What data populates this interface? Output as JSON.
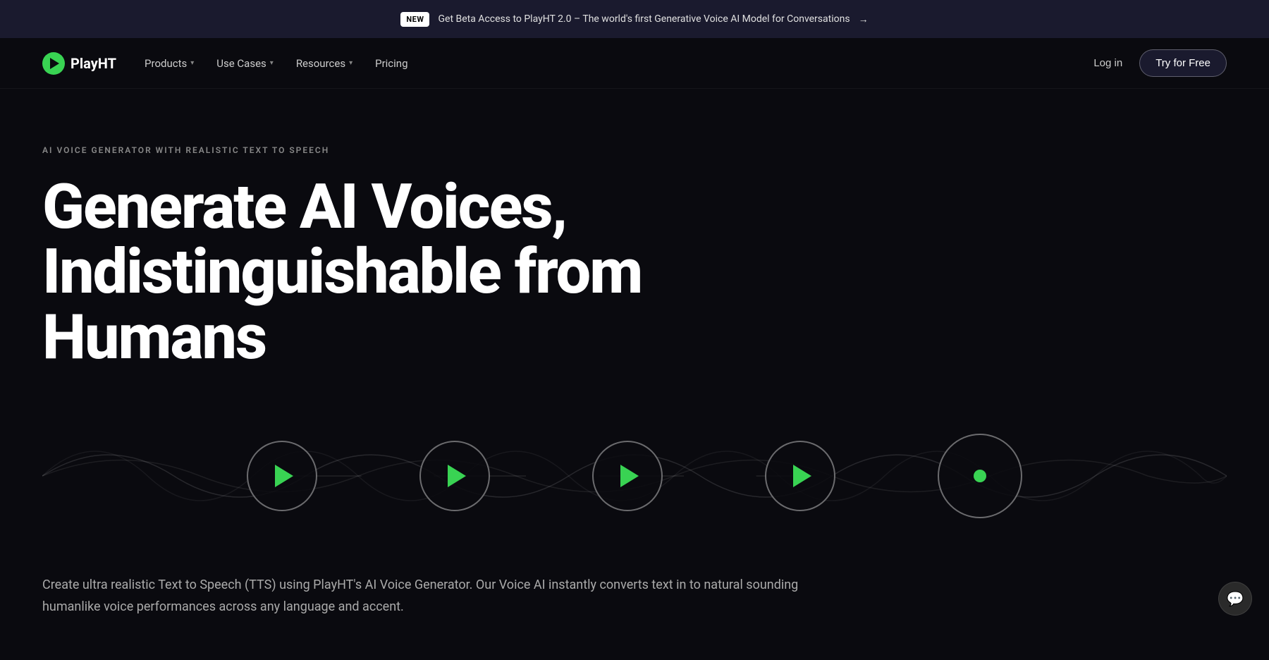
{
  "banner": {
    "badge": "NEW",
    "text": "Get Beta Access to PlayHT 2.0 – The world's first Generative Voice AI Model for Conversations",
    "arrow": "→"
  },
  "navbar": {
    "logo_text": "PlayHT",
    "nav_items": [
      {
        "label": "Products",
        "has_dropdown": true
      },
      {
        "label": "Use Cases",
        "has_dropdown": true
      },
      {
        "label": "Resources",
        "has_dropdown": true
      },
      {
        "label": "Pricing",
        "has_dropdown": false
      }
    ],
    "login_label": "Log in",
    "try_free_label": "Try for Free"
  },
  "hero": {
    "eyebrow": "AI VOICE GENERATOR WITH REALISTIC TEXT TO SPEECH",
    "title_line1": "Generate AI Voices,",
    "title_line2": "Indistinguishable from Humans",
    "description": "Create ultra realistic Text to Speech (TTS) using PlayHT's AI Voice Generator. Our Voice AI instantly converts text in to natural sounding humanlike voice performances across any language and accent.",
    "players": [
      {
        "type": "play",
        "index": 1
      },
      {
        "type": "play",
        "index": 2
      },
      {
        "type": "play",
        "index": 3
      },
      {
        "type": "play",
        "index": 4
      },
      {
        "type": "dot",
        "index": 5
      }
    ]
  },
  "colors": {
    "accent_green": "#39d353",
    "bg_dark": "#0a0a0f",
    "bg_banner": "#1a1a2e"
  }
}
